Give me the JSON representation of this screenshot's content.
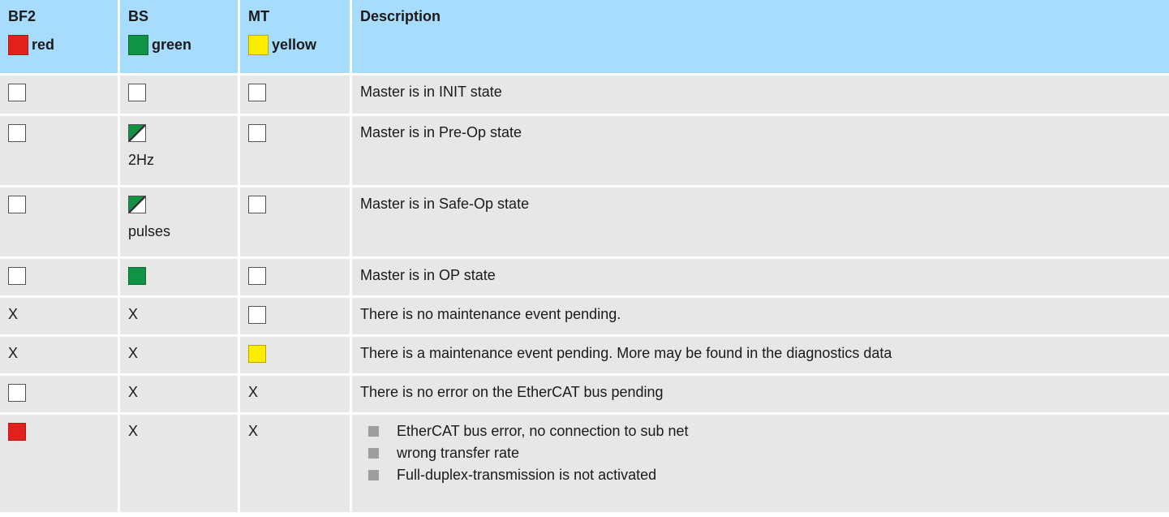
{
  "header": {
    "bf2": "BF2",
    "bs": "BS",
    "mt": "MT",
    "description": "Description",
    "bf2_color": "red",
    "bs_color": "green",
    "mt_color": "yellow"
  },
  "colors": {
    "red": "#e3211c",
    "green": "#109344",
    "yellow": "#ffed00",
    "header_bg": "#a8dcfc",
    "row_bg": "#e7e7e7",
    "bullet": "#9e9e9e"
  },
  "rows": [
    {
      "description": "Master is in INIT state"
    },
    {
      "bs_note": "2Hz",
      "description": "Master is in Pre-Op state"
    },
    {
      "bs_note": "pulses",
      "description": "Master is in Safe-Op state"
    },
    {
      "description": "Master is in OP state"
    },
    {
      "bf2": "X",
      "bs": "X",
      "description": "There is no maintenance event pending."
    },
    {
      "bf2": "X",
      "bs": "X",
      "description": "There is a maintenance event pending. More may be found in the diagnostics data"
    },
    {
      "bs": "X",
      "mt": "X",
      "description": "There is no error on the EtherCAT bus pending"
    },
    {
      "bs": "X",
      "mt": "X",
      "bullets": [
        "EtherCAT bus error, no connection to sub net",
        "wrong transfer rate",
        "Full-duplex-transmission is not activated"
      ]
    }
  ]
}
